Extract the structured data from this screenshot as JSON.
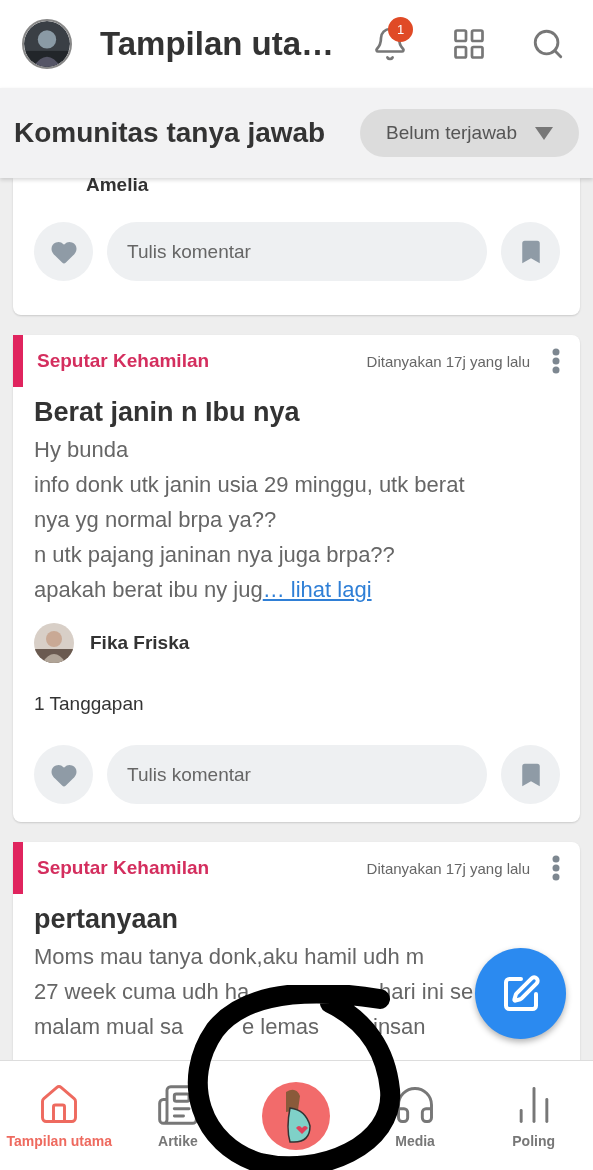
{
  "header": {
    "title": "Tampilan uta…",
    "notification_badge": "1"
  },
  "subheader": {
    "title": "Komunitas tanya jawab",
    "filter": "Belum terjawab"
  },
  "posts": [
    {
      "kind": "partial",
      "author": "Amelia",
      "comment_placeholder": "Tulis komentar"
    },
    {
      "kind": "full",
      "category": "Seputar Kehamilan",
      "time": "Ditanyakan 17j yang lalu",
      "title": "Berat janin n Ibu nya",
      "body": [
        [
          "Hy bunda"
        ],
        [
          "info donk utk janin usia 29 minggu, utk berat"
        ],
        [
          "nya yg normal brpa ya??"
        ],
        [
          "n utk pajang janinan nya juga brpa??"
        ],
        [
          "apakah berat ibu ny jug"
        ]
      ],
      "more": "… lihat lagi",
      "author": "Fika Friska",
      "responses": "1 Tanggapan",
      "comment_placeholder": "Tulis komentar"
    },
    {
      "kind": "full",
      "category": "Seputar Kehamilan",
      "time": "Ditanyakan 17j yang lalu",
      "title": "pertanyaan",
      "body": [
        [
          "Moms mau tanya donk,aku hamil udh m"
        ],
        [
          "27 week cuma udh ha",
          "hari ini se"
        ],
        [
          "malam mual sa",
          "e lemas",
          "insan"
        ]
      ]
    }
  ],
  "nav": [
    {
      "kind": "home",
      "label": "Tampilan utama",
      "selected": true
    },
    {
      "kind": "article",
      "label": "Artike",
      "selected": false
    },
    {
      "kind": "center",
      "selected": false
    },
    {
      "kind": "media",
      "label": "Media",
      "selected": false
    },
    {
      "kind": "poll",
      "label": "Poling",
      "selected": false
    }
  ]
}
